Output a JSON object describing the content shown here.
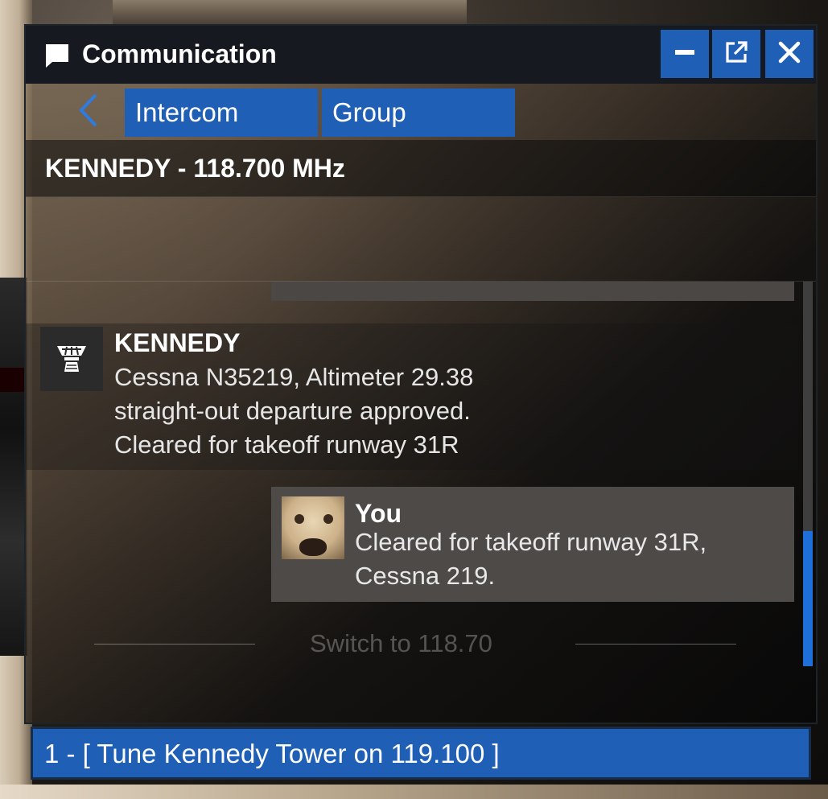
{
  "window": {
    "title": "Communication",
    "title_icon": "chat-bubble-icon",
    "buttons": [
      "minimize-icon",
      "popout-icon",
      "close-icon"
    ]
  },
  "tabs": {
    "back_icon": "chevron-left-icon",
    "items": [
      {
        "label": "Intercom"
      },
      {
        "label": "Group"
      }
    ]
  },
  "frequency": {
    "label": "KENNEDY - 118.700 MHz"
  },
  "messages": {
    "atc": {
      "sender": "KENNEDY",
      "icon": "control-tower-icon",
      "lines": [
        "Cessna N35219, Altimeter 29.38",
        "straight-out departure approved.",
        "Cleared for takeoff runway 31R"
      ]
    },
    "you": {
      "sender": "You",
      "avatar": "dog-avatar",
      "lines": [
        "Cleared for takeoff runway 31R,",
        "Cessna 219."
      ]
    },
    "status": "Switch to 118.70"
  },
  "options": {
    "items": [
      {
        "label": "1 - [ Tune Kennedy Tower on 119.100 ]"
      }
    ]
  },
  "colors": {
    "accent": "#1f5fb5",
    "titlebar": "#161a20",
    "scroll_thumb": "#1f6fd9"
  }
}
